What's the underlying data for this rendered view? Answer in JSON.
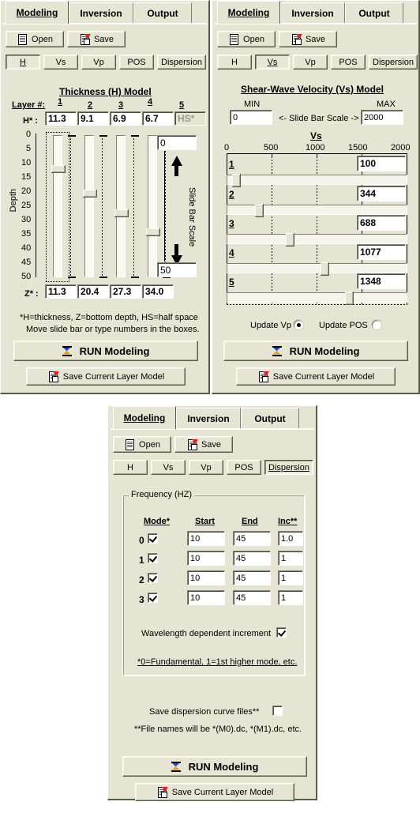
{
  "common": {
    "tabs": [
      "Modeling",
      "Inversion",
      "Output"
    ],
    "toolbar": {
      "open": "Open",
      "save": "Save"
    },
    "subtabs": [
      "H",
      "Vs",
      "Vp",
      "POS",
      "Dispersion"
    ],
    "run_button": "RUN Modeling",
    "save_layer_button": "Save Current Layer Model",
    "icons": {
      "open": "open-document-icon",
      "save": "save-document-icon",
      "run": "hourglass-icon"
    },
    "colors": {
      "face": "#e6e5d4",
      "shadow": "#5a5a4a",
      "highlight": "#ffffff",
      "field_bg": "#ffffff",
      "text": "#000000",
      "disabled_text": "#9a9a8c"
    }
  },
  "panel_h": {
    "selected_tab": "Modeling",
    "selected_subtab": "H",
    "title": "Thickness (H) Model",
    "layer_label": "Layer #:",
    "layer_numbers": [
      "1",
      "2",
      "3",
      "4",
      "5"
    ],
    "h_label": "H* :",
    "h_values": [
      "11.3",
      "9.1",
      "6.9",
      "6.7"
    ],
    "halfspace_label": "HS*",
    "z_label": "Z* :",
    "z_values": [
      "11.3",
      "20.4",
      "27.3",
      "34.0"
    ],
    "depth_axis_label": "Depth",
    "depth_ticks": [
      "0",
      "5",
      "10",
      "15",
      "20",
      "25",
      "30",
      "35",
      "40",
      "45",
      "50"
    ],
    "slider_depths": [
      11.3,
      20.4,
      27.3,
      34.0
    ],
    "scale_label": "Slide Bar Scale",
    "scale_min": "0",
    "scale_max": "50",
    "note_line1": "*H=thickness, Z=bottom depth, HS=half space",
    "note_line2": "Move slide bar or type numbers in the boxes."
  },
  "panel_vs": {
    "selected_tab": "Modeling",
    "selected_subtab": "Vs",
    "title": "Shear-Wave Velocity (Vs) Model",
    "min_label": "MIN",
    "max_label": "MAX",
    "min_value": "0",
    "max_value": "2000",
    "scale_caption": "<- Slide Bar Scale ->",
    "axis_title": "Vs",
    "axis_ticks": [
      "0",
      "500",
      "1000",
      "1500",
      "2000"
    ],
    "axis_min": 0,
    "axis_max": 2000,
    "layers": [
      {
        "n": "1",
        "value": "100",
        "num": 100
      },
      {
        "n": "2",
        "value": "344",
        "num": 344
      },
      {
        "n": "3",
        "value": "688",
        "num": 688
      },
      {
        "n": "4",
        "value": "1077",
        "num": 1077
      },
      {
        "n": "5",
        "value": "1348",
        "num": 1348
      }
    ],
    "update_vp_label": "Update Vp",
    "update_pos_label": "Update POS",
    "update_vp_selected": true,
    "update_pos_selected": false
  },
  "panel_disp": {
    "selected_tab": "Modeling",
    "selected_subtab": "Dispersion",
    "group_title": "Frequency (HZ)",
    "headers": [
      "Mode*",
      "Start",
      "End",
      "Inc**"
    ],
    "rows": [
      {
        "mode": "0",
        "checked": true,
        "start": "10",
        "end": "45",
        "inc": "1.0"
      },
      {
        "mode": "1",
        "checked": true,
        "start": "10",
        "end": "45",
        "inc": "1"
      },
      {
        "mode": "2",
        "checked": true,
        "start": "10",
        "end": "45",
        "inc": "1"
      },
      {
        "mode": "3",
        "checked": true,
        "start": "10",
        "end": "45",
        "inc": "1"
      }
    ],
    "wavelength_label": "Wavelength dependent increment",
    "wavelength_checked": true,
    "mode_note": "*0=Fundamental, 1=1st higher mode, etc.",
    "save_curve_label": "Save dispersion curve files**",
    "save_curve_checked": false,
    "file_note": "**File names will be *(M0).dc, *(M1).dc, etc."
  }
}
